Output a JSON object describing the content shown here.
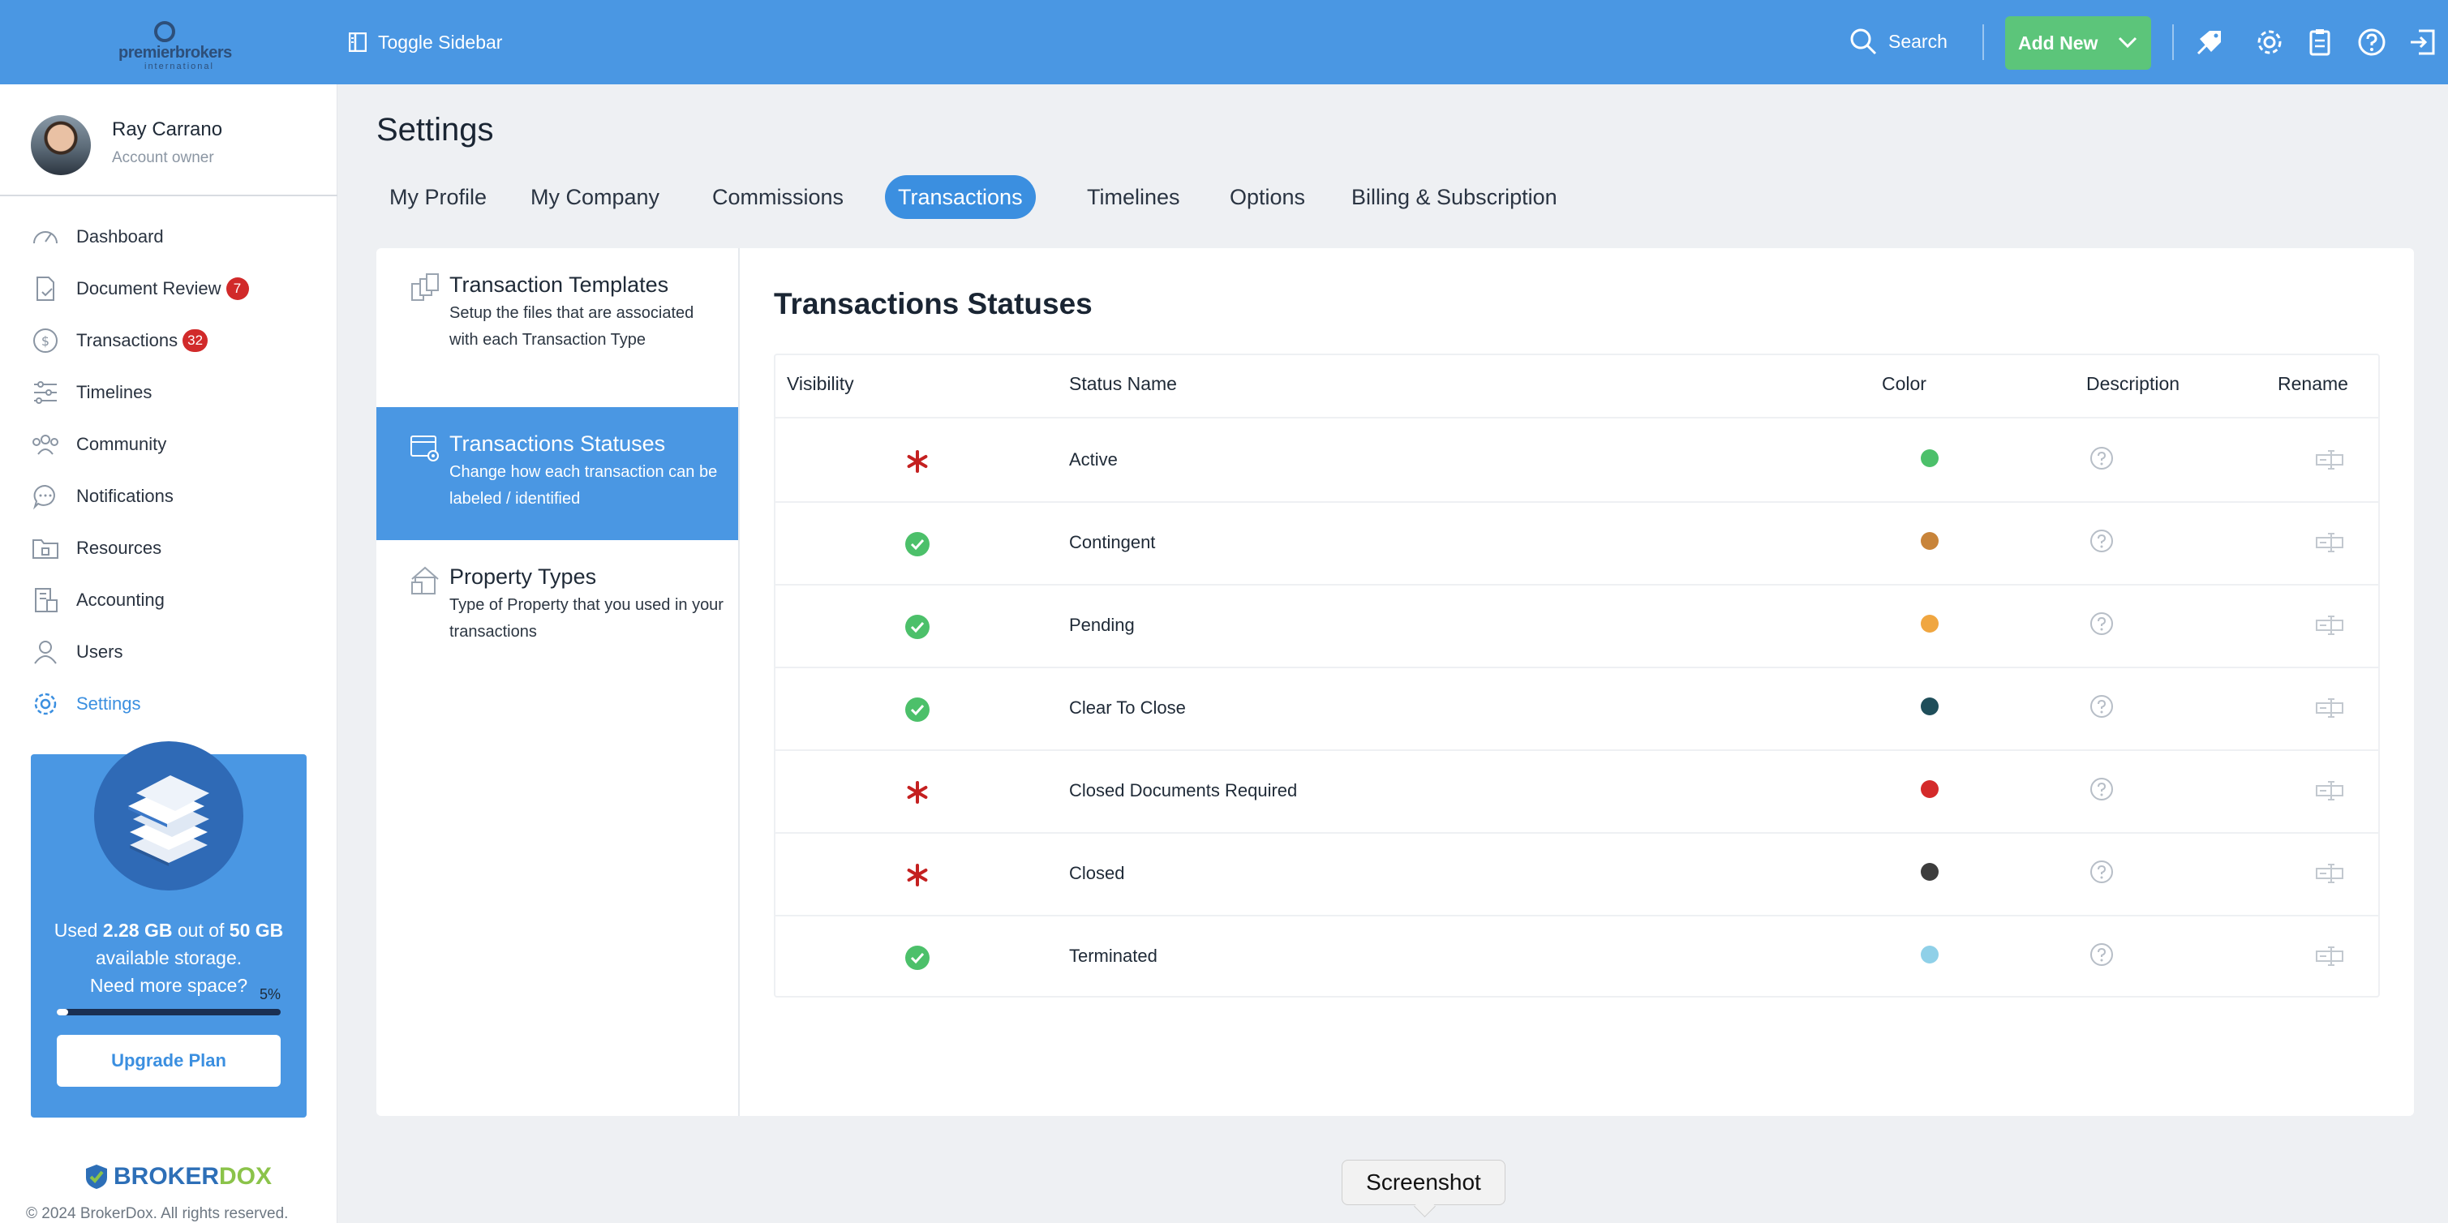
{
  "header": {
    "logo_text": "premierbrokers",
    "logo_sub": "international",
    "toggle_label": "Toggle Sidebar",
    "search_label": "Search",
    "add_new_label": "Add New",
    "icons": [
      "tag-icon",
      "gear-icon",
      "clipboard-icon",
      "help-icon",
      "logout-icon"
    ]
  },
  "user": {
    "name": "Ray Carrano",
    "role": "Account owner"
  },
  "sidebar": {
    "items": [
      {
        "label": "Dashboard",
        "icon": "gauge-icon",
        "badge": ""
      },
      {
        "label": "Document Review",
        "icon": "document-check-icon",
        "badge": "7"
      },
      {
        "label": "Transactions",
        "icon": "dollar-icon",
        "badge": "32"
      },
      {
        "label": "Timelines",
        "icon": "timeline-icon",
        "badge": ""
      },
      {
        "label": "Community",
        "icon": "people-icon",
        "badge": ""
      },
      {
        "label": "Notifications",
        "icon": "chat-icon",
        "badge": ""
      },
      {
        "label": "Resources",
        "icon": "folder-icon",
        "badge": ""
      },
      {
        "label": "Accounting",
        "icon": "building-icon",
        "badge": ""
      },
      {
        "label": "Users",
        "icon": "user-icon",
        "badge": ""
      },
      {
        "label": "Settings",
        "icon": "gear-icon",
        "badge": ""
      }
    ],
    "active_index": 9
  },
  "storage": {
    "line1_pre": "Used ",
    "used": "2.28 GB",
    "line1_mid": " out of ",
    "total": "50 GB",
    "line1_post": " available storage.",
    "line2": "Need more space?",
    "percent_label": "5%",
    "percent_value": 0.05,
    "upgrade_label": "Upgrade Plan"
  },
  "footer": {
    "brand_a": "BROKER",
    "brand_b": "DOX",
    "copyright": "© 2024 BrokerDox. All rights reserved."
  },
  "page": {
    "title": "Settings",
    "tabs": [
      "My Profile",
      "My Company",
      "Commissions",
      "Transactions",
      "Timelines",
      "Options",
      "Billing & Subscription"
    ],
    "active_tab": 3
  },
  "settings_menu": [
    {
      "title": "Transaction Templates",
      "desc": "Setup the files that are associated with each Transaction Type",
      "icon": "templates-icon"
    },
    {
      "title": "Transactions Statuses",
      "desc": "Change how each transaction can be labeled / identified",
      "icon": "status-settings-icon"
    },
    {
      "title": "Property Types",
      "desc": "Type of Property that you used in your transactions",
      "icon": "house-icon"
    }
  ],
  "statuses": {
    "title": "Transactions Statuses",
    "columns": [
      "Visibility",
      "Status Name",
      "Color",
      "Description",
      "Rename"
    ],
    "rows": [
      {
        "name": "Active",
        "visibility": "required",
        "color": "#4cc06a"
      },
      {
        "name": "Contingent",
        "visibility": "check",
        "color": "#c8843a"
      },
      {
        "name": "Pending",
        "visibility": "check",
        "color": "#f0a640"
      },
      {
        "name": "Clear To Close",
        "visibility": "check",
        "color": "#1f4e5a"
      },
      {
        "name": "Closed Documents Required",
        "visibility": "required",
        "color": "#d42a2a"
      },
      {
        "name": "Closed",
        "visibility": "required",
        "color": "#3d3d3d"
      },
      {
        "name": "Terminated",
        "visibility": "check",
        "color": "#8fd0e8"
      }
    ]
  },
  "tooltip": "Screenshot",
  "colors": {
    "primary": "#4a97e3",
    "accent_green": "#5cc57a",
    "badge_red": "#d12a2a"
  }
}
